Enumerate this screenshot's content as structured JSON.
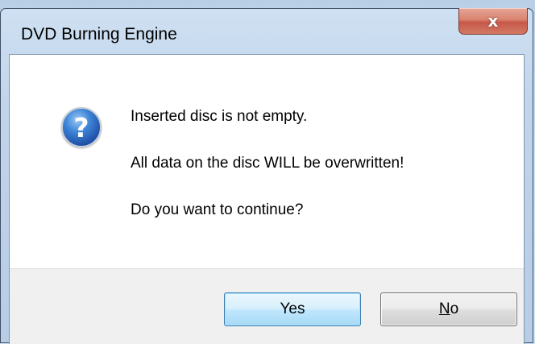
{
  "window": {
    "title": "DVD Burning Engine",
    "close_glyph": "x"
  },
  "dialog": {
    "icon": "question-icon",
    "messages": [
      "Inserted disc is not empty.",
      "All data on the disc WILL be overwritten!",
      "Do you want to continue?"
    ]
  },
  "buttons": {
    "yes_label": "Yes",
    "no_mnemonic": "N",
    "no_rest": "o"
  },
  "colors": {
    "close_button": "#c6584a",
    "default_button_border": "#3c7fb1"
  }
}
